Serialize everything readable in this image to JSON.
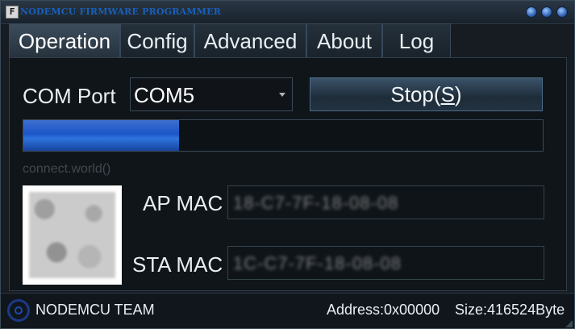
{
  "window": {
    "title": "NODEMCU FIRMWARE PROGRAMMER",
    "app_icon": "F"
  },
  "tabs": [
    {
      "label": "Operation",
      "active": true
    },
    {
      "label": "Config",
      "active": false
    },
    {
      "label": "Advanced",
      "active": false
    },
    {
      "label": "About",
      "active": false
    },
    {
      "label": "Log",
      "active": false
    }
  ],
  "operation": {
    "com_port_label": "COM Port",
    "com_port_value": "COM5",
    "stop_button_prefix": "Stop(",
    "stop_button_accel": "S",
    "stop_button_suffix": ")",
    "progress": 0.3,
    "status_text": "connect.world()",
    "ap_mac_label": "AP MAC",
    "ap_mac_value": "18-C7-7F-18-08-08",
    "sta_mac_label": "STA MAC",
    "sta_mac_value": "1C-C7-7F-18-08-08"
  },
  "footer": {
    "team": "NODEMCU TEAM",
    "address": "Address:0x00000",
    "size": "Size:416524Byte"
  },
  "colors": {
    "accent": "#1c56c7",
    "title": "#1a5fb8"
  }
}
